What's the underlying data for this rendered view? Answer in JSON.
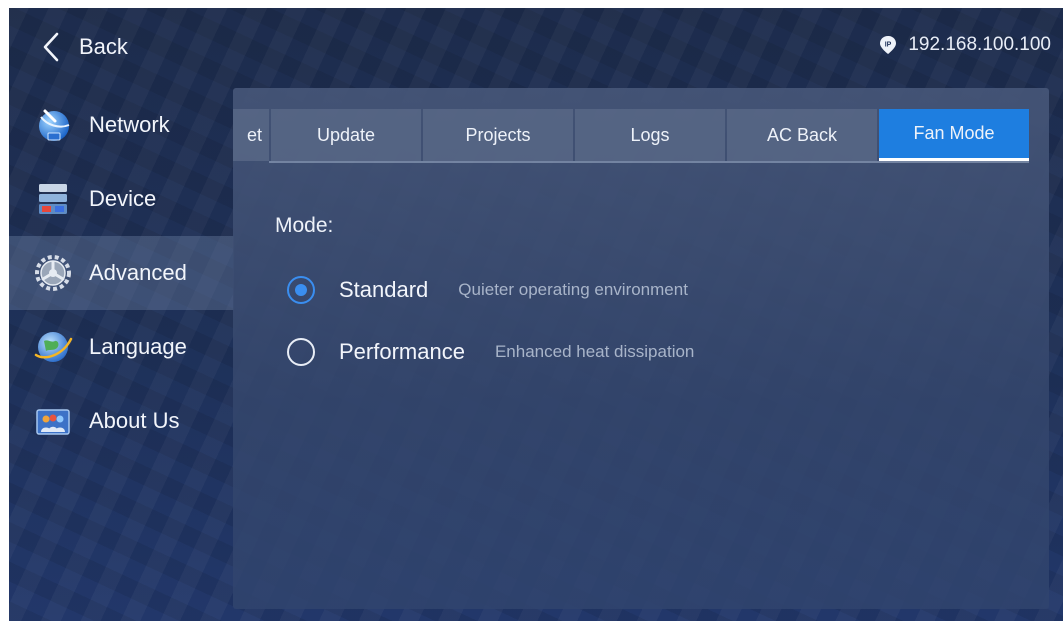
{
  "topbar": {
    "back_label": "Back",
    "ip_address": "192.168.100.100",
    "ip_icon": "ip-pin-icon"
  },
  "sidebar": {
    "items": [
      {
        "label": "Network",
        "icon": "network-icon",
        "active": false
      },
      {
        "label": "Device",
        "icon": "device-icon",
        "active": false
      },
      {
        "label": "Advanced",
        "icon": "gear-icon",
        "active": true
      },
      {
        "label": "Language",
        "icon": "globe-icon",
        "active": false
      },
      {
        "label": "About Us",
        "icon": "people-icon",
        "active": false
      }
    ]
  },
  "tabs": [
    {
      "label": "et",
      "active": false
    },
    {
      "label": "Update",
      "active": false
    },
    {
      "label": "Projects",
      "active": false
    },
    {
      "label": "Logs",
      "active": false
    },
    {
      "label": "AC Back",
      "active": false
    },
    {
      "label": "Fan Mode",
      "active": true
    }
  ],
  "content": {
    "mode_label": "Mode:",
    "options": [
      {
        "title": "Standard",
        "description": "Quieter operating environment",
        "selected": true
      },
      {
        "title": "Performance",
        "description": "Enhanced heat dissipation",
        "selected": false
      }
    ]
  },
  "colors": {
    "accent": "#1e7ee0",
    "radio_selected": "#3a8ef0",
    "background": "#1e3159"
  }
}
